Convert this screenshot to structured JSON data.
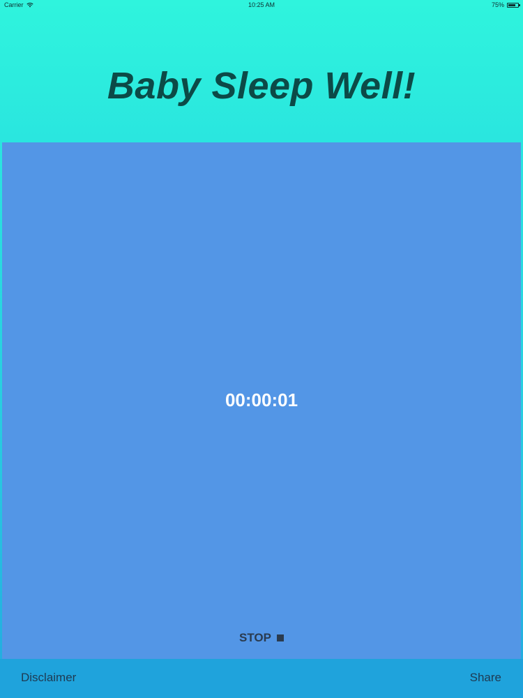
{
  "status_bar": {
    "carrier": "Carrier",
    "wifi_icon": "wifi-icon",
    "time": "10:25 AM",
    "battery_percent": "75%",
    "battery_level": 0.75,
    "battery_icon": "battery-icon"
  },
  "header": {
    "title": "Baby Sleep Well!"
  },
  "timer": {
    "elapsed": "00:00:01",
    "stop_label": "STOP",
    "stop_icon": "stop-square-icon"
  },
  "footer": {
    "disclaimer_label": "Disclaimer",
    "share_label": "Share"
  },
  "colors": {
    "background_top": "#2ff4dd",
    "panel": "#5396e6",
    "footer": "#1fa3dc",
    "title": "#0c4a47"
  }
}
